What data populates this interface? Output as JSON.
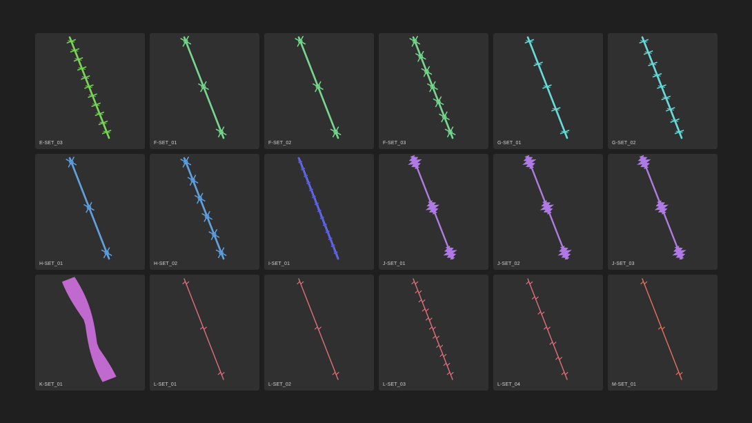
{
  "assets": [
    {
      "label": "E-SET_03",
      "color": "#74d650",
      "style": "ticks",
      "count": 11
    },
    {
      "label": "F-SET_01",
      "color": "#72d68a",
      "style": "stars",
      "count": 3
    },
    {
      "label": "F-SET_02",
      "color": "#72d68a",
      "style": "stars",
      "count": 3
    },
    {
      "label": "F-SET_03",
      "color": "#72d68a",
      "style": "stars",
      "count": 7
    },
    {
      "label": "G-SET_01",
      "color": "#5fdcd8",
      "style": "ticks",
      "count": 5
    },
    {
      "label": "G-SET_02",
      "color": "#5fdcd8",
      "style": "ticks",
      "count": 9
    },
    {
      "label": "H-SET_01",
      "color": "#5a9ee0",
      "style": "stars",
      "count": 3
    },
    {
      "label": "H-SET_02",
      "color": "#5a9ee0",
      "style": "stars",
      "count": 6
    },
    {
      "label": "I-SET_01",
      "color": "#5a5ee0",
      "style": "dense",
      "count": 14
    },
    {
      "label": "J-SET_01",
      "color": "#b07ae6",
      "style": "razor",
      "count": 3
    },
    {
      "label": "J-SET_02",
      "color": "#b07ae6",
      "style": "razor",
      "count": 3
    },
    {
      "label": "J-SET_03",
      "color": "#b07ae6",
      "style": "razor",
      "count": 3
    },
    {
      "label": "K-SET_01",
      "color": "#d070e0",
      "style": "ribbon",
      "count": 0
    },
    {
      "label": "L-SET_01",
      "color": "#e0707c",
      "style": "thin",
      "count": 3
    },
    {
      "label": "L-SET_02",
      "color": "#e0707c",
      "style": "thin",
      "count": 3
    },
    {
      "label": "L-SET_03",
      "color": "#e0707c",
      "style": "thin",
      "count": 11
    },
    {
      "label": "L-SET_04",
      "color": "#e0707c",
      "style": "thin",
      "count": 7
    },
    {
      "label": "M-SET_01",
      "color": "#e87060",
      "style": "thin",
      "count": 3
    }
  ]
}
